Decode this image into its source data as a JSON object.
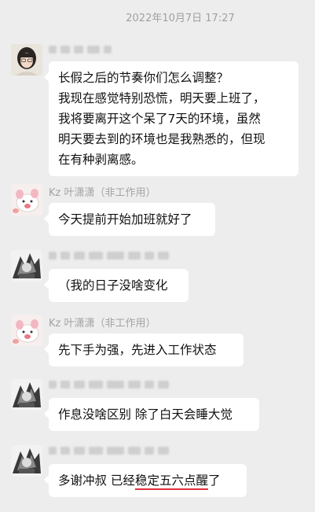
{
  "timestamp": "2022年10月7日 17:27",
  "messages": [
    {
      "sender": "",
      "lines": [
        "长假之后的节奏你们怎么调整？",
        "我现在感觉特别恐慌，明天要上班了，",
        "我将要离开这个呆了7天的环境，虽然",
        "明天要去到的环境也是我熟悉的，但现",
        "在有种剥离感。"
      ]
    },
    {
      "sender": "Kz 叶潇潇（非工作用）",
      "text": "今天提前开始加班就好了"
    },
    {
      "sender": "",
      "text": "（我的日子没啥变化"
    },
    {
      "sender": "Kz 叶潇潇（非工作用）",
      "text": "先下手为强，先进入工作状态"
    },
    {
      "sender": "",
      "text": "作息没啥区别 除了白天会睡大觉"
    },
    {
      "sender": "",
      "text_before": "多谢冲叔 已经",
      "text_underlined": "稳定五六点醒",
      "text_after": "了"
    }
  ],
  "colors": {
    "background": "#ededed",
    "bubble": "#ffffff",
    "sender_name": "#a3a3a3",
    "underline": "#e0303a"
  }
}
